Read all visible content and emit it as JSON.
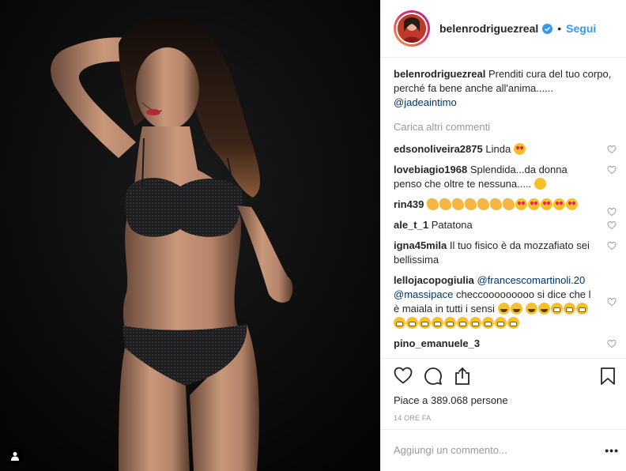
{
  "post": {
    "username": "belenrodriguezreal",
    "follow_label": "Segui",
    "separator": "•"
  },
  "caption": {
    "username": "belenrodriguezreal",
    "text": "Prenditi cura del tuo corpo, perché fa bene anche all'anima......",
    "mention": "@jadeaintimo"
  },
  "load_more_label": "Carica altri commenti",
  "comments": [
    {
      "username": "edsonoliveira2875",
      "text": "Linda"
    },
    {
      "username": "lovebiagio1968",
      "text": "Splendida...da donna penso che oltre te nessuna....."
    },
    {
      "username": "rin439",
      "text": ""
    },
    {
      "username": "ale_t_1",
      "text": "Patatona"
    },
    {
      "username": "igna45mila",
      "text": "Il tuo fisico è da mozzafiato sei bellissima"
    },
    {
      "username": "lellojacopogiulia",
      "mention1": "@francescomartinoli.20",
      "mention2": "@massipace",
      "text": "checcooooooooo si dice che l è maiala in tutti i sensi"
    },
    {
      "username": "pino_emanuele_3",
      "text": ""
    }
  ],
  "likes": {
    "text": "Piace a 389.068 persone"
  },
  "timestamp": "14 ORE FA",
  "add_comment_placeholder": "Aggiungi un commento...",
  "more_label": "•••",
  "icons": {
    "like": "heart-icon",
    "comment": "comment-icon",
    "share": "share-icon",
    "save": "bookmark-icon",
    "verified": "verified-badge-icon",
    "tag": "user-tag-icon"
  },
  "colors": {
    "link_blue": "#3897f0",
    "mention_blue": "#003569",
    "muted": "#999999",
    "text": "#262626"
  }
}
